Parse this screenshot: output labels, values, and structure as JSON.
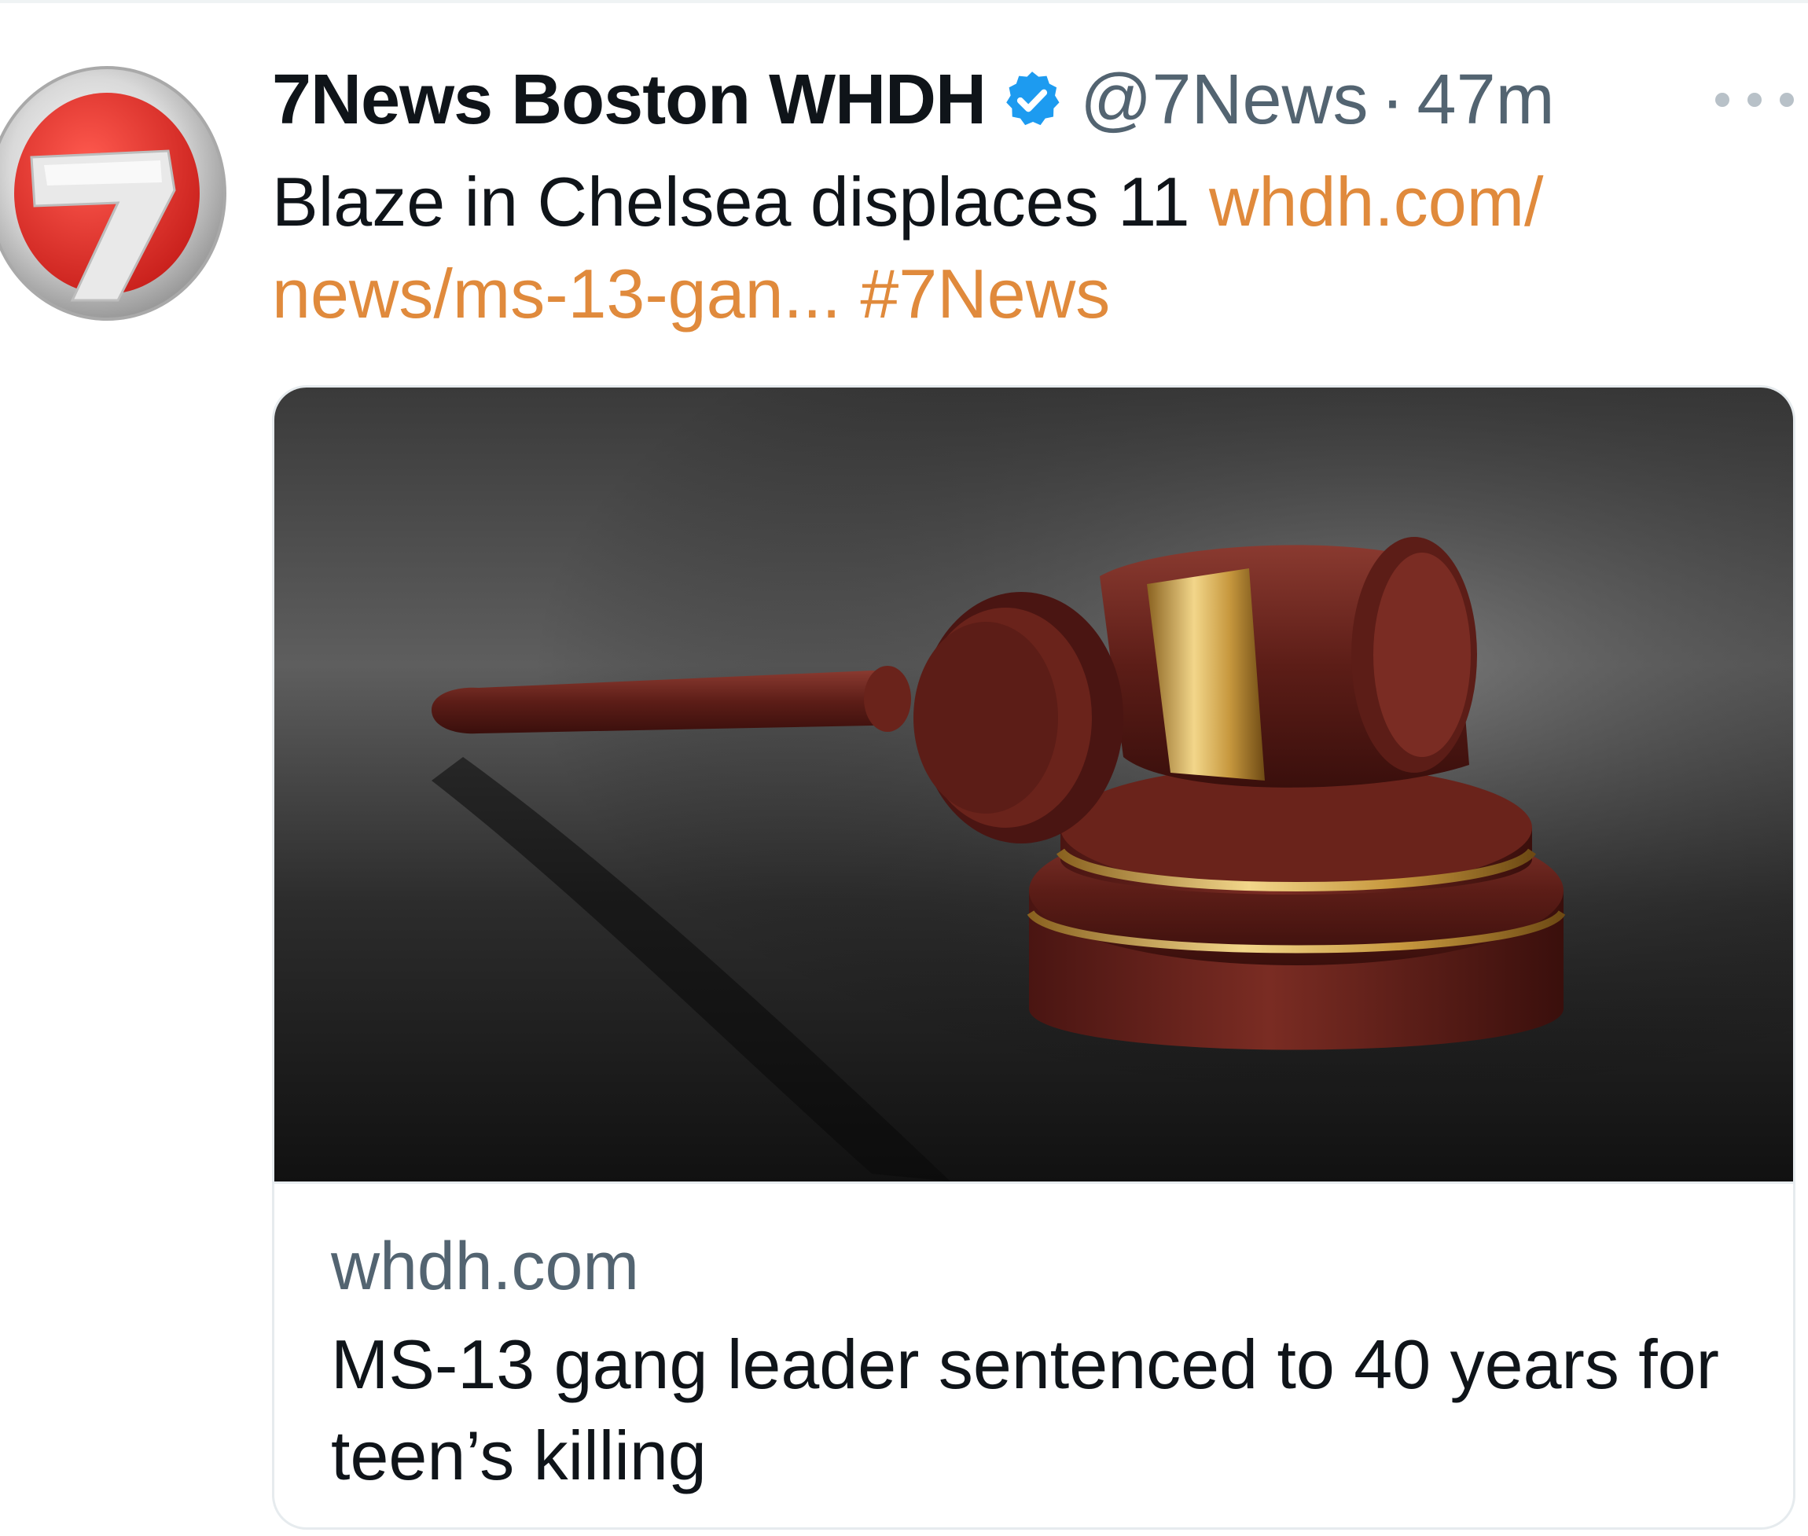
{
  "tweet": {
    "display_name": "7News Boston WHDH",
    "verified": true,
    "handle": "@7News",
    "separator": "·",
    "time": "47m",
    "text": "Blaze in Chelsea displaces 11",
    "link_text": "whdh.com/news/ms-13-gan...",
    "link_text_line1": "whdh.com/",
    "link_text_line2": "news/ms-13-gan...",
    "hashtag": "#7News",
    "avatar_icon": "7news-logo-icon",
    "more_icon": "more-options-icon"
  },
  "card": {
    "image_icon": "gavel-image",
    "domain": "whdh.com",
    "title": "MS-13 gang leader sentenced to 40 years for teen’s killing"
  },
  "colors": {
    "link": "#e08a3c",
    "verified": "#1d9bf0",
    "secondary_text": "#536471",
    "logo_red": "#e0302c"
  }
}
